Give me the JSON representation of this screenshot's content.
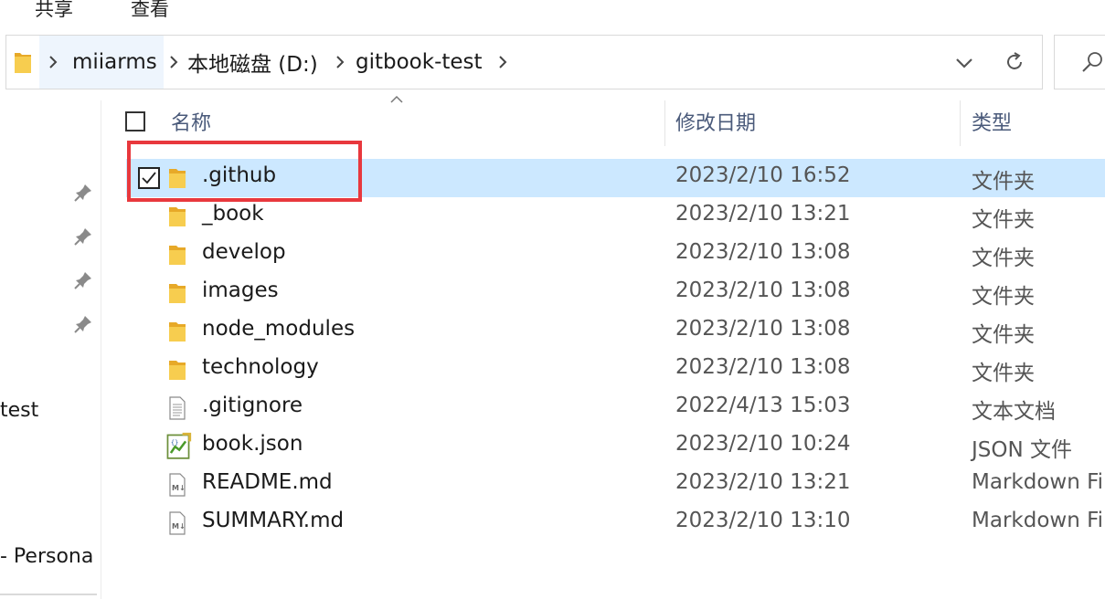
{
  "ribbon": {
    "tabs": [
      "共享",
      "查看"
    ]
  },
  "address_bar": {
    "breadcrumbs": [
      "miiarms",
      "本地磁盘 (D:)",
      "gitbook-test"
    ],
    "icons": {
      "folder": "folder-icon",
      "chevron": "chevron-right-icon",
      "dropdown": "chevron-down-icon",
      "refresh": "refresh-icon",
      "search": "search-icon"
    }
  },
  "nav_pane": {
    "pinned_icons": [
      "pin-icon",
      "pin-icon",
      "pin-icon",
      "pin-icon"
    ],
    "labels": [
      "test",
      "- Persona"
    ]
  },
  "columns": {
    "name": "名称",
    "date_modified": "修改日期",
    "type": "类型"
  },
  "files": [
    {
      "name": ".github",
      "date": "2023/2/10 16:52",
      "type": "文件夹",
      "icon": "folder-icon",
      "selected": true,
      "checked": true
    },
    {
      "name": "_book",
      "date": "2023/2/10 13:21",
      "type": "文件夹",
      "icon": "folder-icon",
      "selected": false,
      "checked": false
    },
    {
      "name": "develop",
      "date": "2023/2/10 13:08",
      "type": "文件夹",
      "icon": "folder-icon",
      "selected": false,
      "checked": false
    },
    {
      "name": "images",
      "date": "2023/2/10 13:08",
      "type": "文件夹",
      "icon": "folder-icon",
      "selected": false,
      "checked": false
    },
    {
      "name": "node_modules",
      "date": "2023/2/10 13:08",
      "type": "文件夹",
      "icon": "folder-icon",
      "selected": false,
      "checked": false
    },
    {
      "name": "technology",
      "date": "2023/2/10 13:08",
      "type": "文件夹",
      "icon": "folder-icon",
      "selected": false,
      "checked": false
    },
    {
      "name": ".gitignore",
      "date": "2022/4/13 15:03",
      "type": "文本文档",
      "icon": "text-file-icon",
      "selected": false,
      "checked": false
    },
    {
      "name": "book.json",
      "date": "2023/2/10 10:24",
      "type": "JSON 文件",
      "icon": "json-file-icon",
      "selected": false,
      "checked": false
    },
    {
      "name": "README.md",
      "date": "2023/2/10 13:21",
      "type": "Markdown Fi",
      "icon": "markdown-file-icon",
      "selected": false,
      "checked": false
    },
    {
      "name": "SUMMARY.md",
      "date": "2023/2/10 13:10",
      "type": "Markdown Fi",
      "icon": "markdown-file-icon",
      "selected": false,
      "checked": false
    }
  ],
  "colors": {
    "selection": "#cce8ff",
    "highlight_annotation": "#e8383d",
    "folder": "#f5c446"
  }
}
